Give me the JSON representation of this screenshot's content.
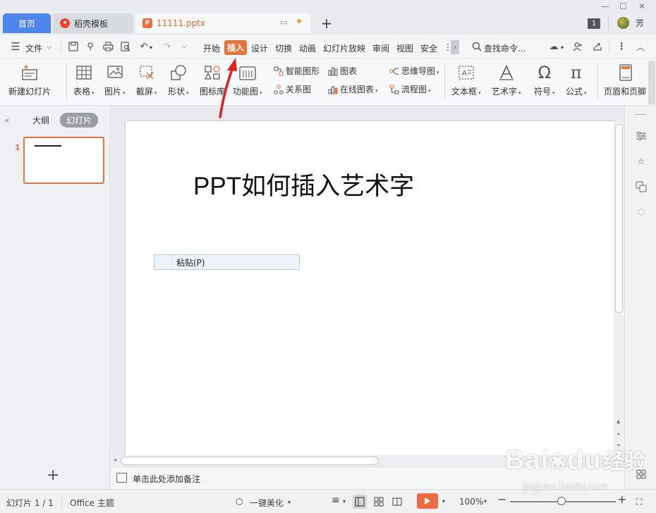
{
  "tabs": {
    "home": "首页",
    "template": "稻壳模板",
    "file": "11111.pptx",
    "window_badge": "1",
    "user": "芳"
  },
  "menu": {
    "file": "文件",
    "items": [
      "开始",
      "插入",
      "设计",
      "切换",
      "动画",
      "幻灯片放映",
      "审阅",
      "视图",
      "安全"
    ],
    "more": "⋮",
    "search": "查找命令..."
  },
  "ribbon": {
    "new_slide": "新建幻灯片",
    "table": "表格",
    "picture": "图片",
    "screenshot": "截屏",
    "shape": "形状",
    "icon_lib": "图标库",
    "function_chart": "功能图",
    "smart_art": "智能图形",
    "chart": "图表",
    "relation": "关系图",
    "online_chart": "在线图表",
    "mind_map": "思维导图",
    "flowchart": "流程图",
    "textbox": "文本框",
    "art_text": "艺术字",
    "symbol": "符号",
    "formula": "公式",
    "header_footer": "页眉和页脚"
  },
  "panel": {
    "outline": "大纲",
    "slides": "幻灯片",
    "slide_number": "1"
  },
  "slide": {
    "title": "PPT如何插入艺术字",
    "context_menu_item": "粘贴(P)"
  },
  "notes": {
    "placeholder": "单击此处添加备注"
  },
  "status": {
    "slide_counter": "幻灯片 1 / 1",
    "theme": "Office 主题",
    "beautify": "一键美化",
    "zoom": "100%"
  },
  "watermark": {
    "brand": "Bai",
    "brand2": "du",
    "brand_cn": "经验",
    "url": "jingyan.baidu.com"
  },
  "colors": {
    "accent": "#e5743a",
    "home_tab": "#4f86ec",
    "arrow": "#e02020"
  }
}
